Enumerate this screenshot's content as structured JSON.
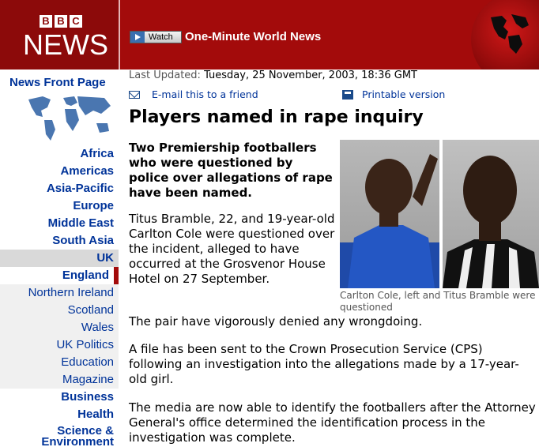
{
  "header": {
    "bbc_letters": [
      "B",
      "B",
      "C"
    ],
    "logo_text": "NEWS",
    "watch_label": "Watch",
    "watch_title": "One-Minute World News"
  },
  "sidebar": {
    "front_page": "News Front Page",
    "items": [
      {
        "label": "Africa",
        "style": "bold"
      },
      {
        "label": "Americas",
        "style": "bold"
      },
      {
        "label": "Asia-Pacific",
        "style": "bold"
      },
      {
        "label": "Europe",
        "style": "bold"
      },
      {
        "label": "Middle East",
        "style": "bold"
      },
      {
        "label": "South Asia",
        "style": "bold"
      },
      {
        "label": "UK",
        "style": "bold current"
      },
      {
        "label": "England",
        "style": "bold active"
      },
      {
        "label": "Northern Ireland",
        "style": "sub"
      },
      {
        "label": "Scotland",
        "style": "sub"
      },
      {
        "label": "Wales",
        "style": "sub"
      },
      {
        "label": "UK Politics",
        "style": "sub"
      },
      {
        "label": "Education",
        "style": "sub"
      },
      {
        "label": "Magazine",
        "style": "sub"
      },
      {
        "label": "Business",
        "style": "bold"
      },
      {
        "label": "Health",
        "style": "bold"
      },
      {
        "label": "Science & Environment",
        "style": "bold last"
      }
    ]
  },
  "article": {
    "updated_label": "Last Updated:",
    "updated_date": "Tuesday, 25 November, 2003, 18:36 GMT",
    "email_label": "E-mail this to a friend",
    "print_label": "Printable version",
    "headline": "Players named in rape inquiry",
    "intro": "Two Premiership footballers who were questioned by police over allegations of rape have been named.",
    "paragraphs": [
      "Titus Bramble, 22, and 19-year-old Carlton Cole were questioned over the incident, alleged to have occurred at the Grosvenor House Hotel on 27 September.",
      "The pair have vigorously denied any wrongdoing.",
      "A file has been sent to the Crown Prosecution Service (CPS) following an investigation into the allegations made by a 17-year-old girl.",
      "The media are now able to identify the footballers after the Attorney General's office determined the identification process in the investigation was complete."
    ],
    "photo_caption": "Carlton Cole, left and Titus Bramble were questioned"
  },
  "colors": {
    "brand_red": "#a30b0b",
    "link_blue": "#003399"
  }
}
